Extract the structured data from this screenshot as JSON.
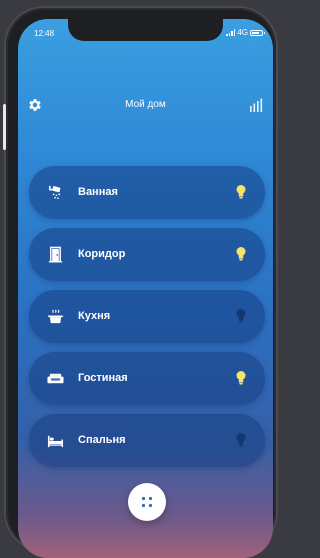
{
  "status_bar": {
    "time": "12:48",
    "network": "4G"
  },
  "header": {
    "title": "Мой дом",
    "settings_icon": "gear-icon",
    "stats_icon": "bar-chart-icon"
  },
  "rooms": [
    {
      "label": "Ванная",
      "icon": "shower-icon",
      "light_on": true
    },
    {
      "label": "Коридор",
      "icon": "door-icon",
      "light_on": true
    },
    {
      "label": "Кухня",
      "icon": "pot-icon",
      "light_on": false
    },
    {
      "label": "Гостиная",
      "icon": "sofa-icon",
      "light_on": true
    },
    {
      "label": "Спальня",
      "icon": "bed-icon",
      "light_on": false
    }
  ],
  "fab_icon": "dots-grid-icon",
  "colors": {
    "bulb_on": "#f6e36a",
    "bulb_off": "#14386e",
    "accent": "#2e86d4"
  }
}
